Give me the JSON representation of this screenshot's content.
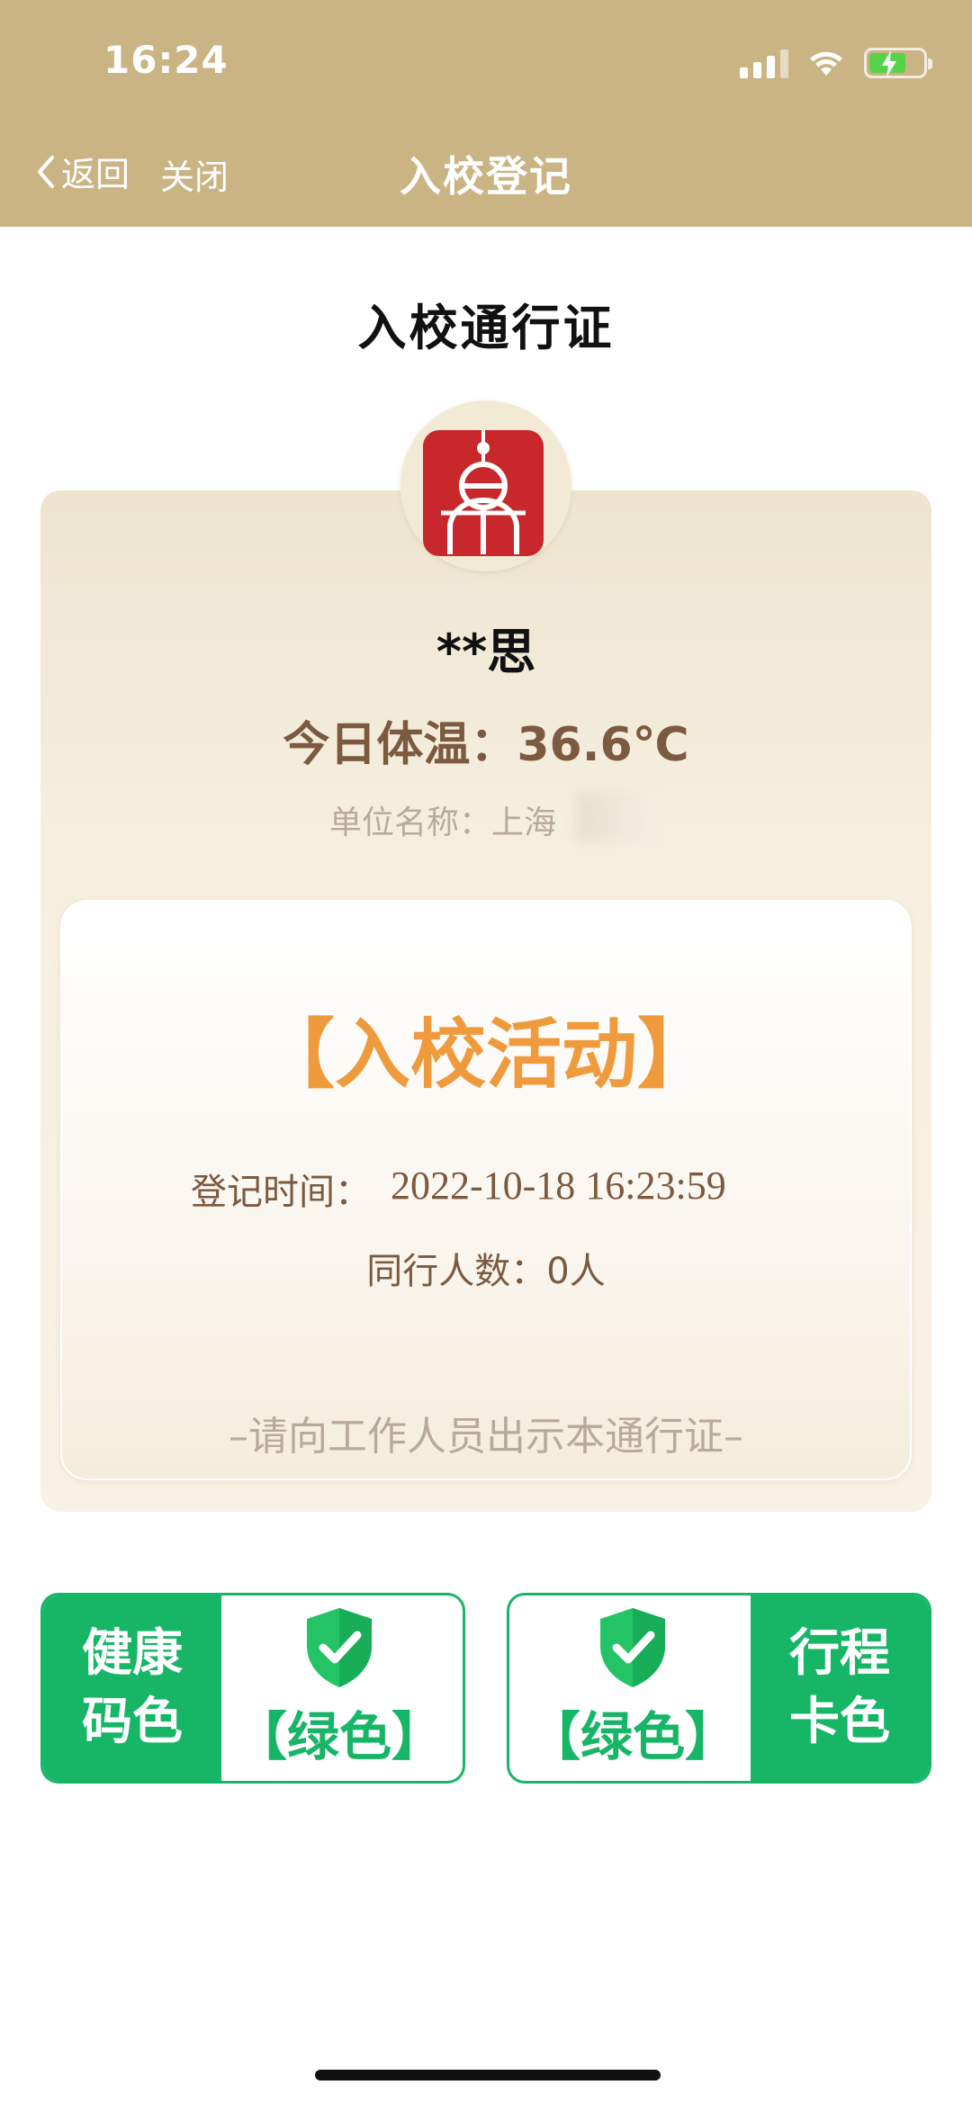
{
  "status_bar": {
    "time": "16:24"
  },
  "nav": {
    "back_label": "返回",
    "close_label": "关闭",
    "title": "入校登记"
  },
  "page": {
    "title": "入校通行证"
  },
  "pass": {
    "name": "**思",
    "temperature": "今日体温：36.6℃",
    "unit_label": "单位名称：上海",
    "activity": "【入校活动】",
    "register_time_label": "登记时间：",
    "register_time_value": "2022-10-18 16:23:59",
    "companions": "同行人数：0人",
    "hint": "–请向工作人员出示本通行证–"
  },
  "health_code": {
    "label_line1": "健康",
    "label_line2": "码色",
    "status": "【绿色】"
  },
  "travel_card": {
    "label_line1": "行程",
    "label_line2": "卡色",
    "status": "【绿色】"
  },
  "colors": {
    "header": "#cab484",
    "green": "#17b667",
    "orange": "#f09a3e",
    "brown": "#7b5a40"
  }
}
